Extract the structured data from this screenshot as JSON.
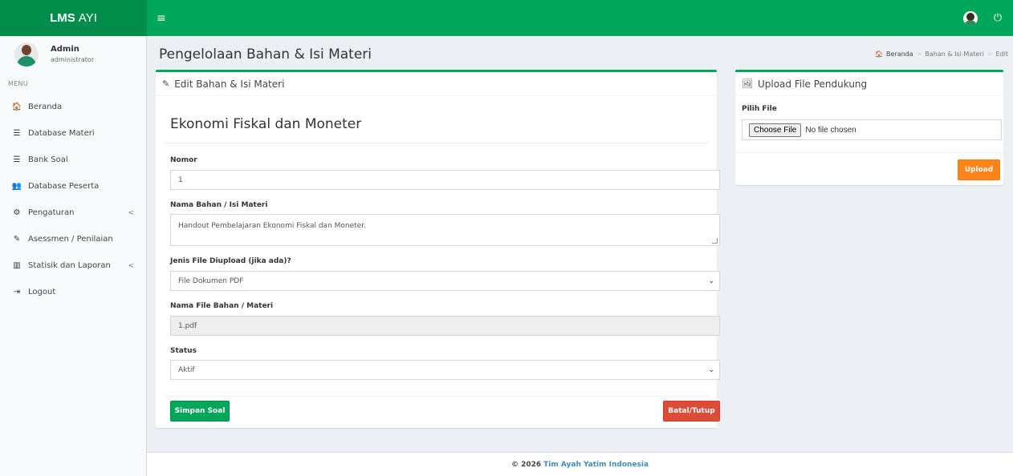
{
  "app": {
    "logo_bold": "LMS",
    "logo_light": "AYI",
    "menu_toggle_icon": "≡",
    "power_icon": "⏻",
    "brand_color": "#00a65a"
  },
  "user": {
    "name": "Admin",
    "role": "administrator"
  },
  "sidebar": {
    "header": "MENU",
    "items": [
      {
        "label": "Beranda",
        "icon": "home-icon",
        "glyph": "🏠"
      },
      {
        "label": "Database Materi",
        "icon": "database-icon",
        "glyph": "☰"
      },
      {
        "label": "Bank Soal",
        "icon": "database-icon",
        "glyph": "☰"
      },
      {
        "label": "Database Peserta",
        "icon": "users-icon",
        "glyph": "👥"
      },
      {
        "label": "Pengaturan",
        "icon": "cog-icon",
        "glyph": "⚙",
        "chevron": "<"
      },
      {
        "label": "Asessmen / Penilaian",
        "icon": "edit-icon",
        "glyph": "✎"
      },
      {
        "label": "Statisik dan Laporan",
        "icon": "bar-chart-icon",
        "glyph": "▥",
        "chevron": "<"
      },
      {
        "label": "Logout",
        "icon": "sign-out-icon",
        "glyph": "⇥"
      }
    ]
  },
  "page": {
    "title": "Pengelolaan Bahan & Isi Materi",
    "breadcrumb": [
      "Beranda",
      "Bahan & Isi Materi",
      "Edit"
    ],
    "breadcrumb_sep": ">"
  },
  "edit_box": {
    "header": "Edit Bahan & Isi Materi",
    "subject_title": "Ekonomi Fiskal dan Moneter",
    "fields": {
      "nomor": {
        "label": "Nomor",
        "value": "1"
      },
      "nama": {
        "label": "Nama Bahan / Isi Materi",
        "value": "Handout Pembelajaran Ekonomi Fiskal dan Moneter."
      },
      "jenis": {
        "label": "Jenis File Diupload (jika ada)?",
        "value": "File Dokumen PDF"
      },
      "nama_file": {
        "label": "Nama File Bahan / Materi",
        "value": "1.pdf"
      },
      "status": {
        "label": "Status",
        "value": "Aktif"
      }
    },
    "save_label": "Simpan Soal",
    "cancel_label": "Batal/Tutup"
  },
  "upload_box": {
    "header": "Upload File Pendukung",
    "file_label": "Pilih File",
    "choose_label": "Choose File",
    "no_file_text": "No file chosen",
    "upload_label": "Upload"
  },
  "footer": {
    "copyright": "© 2026",
    "org": "Tim Ayah Yatim Indonesia"
  }
}
